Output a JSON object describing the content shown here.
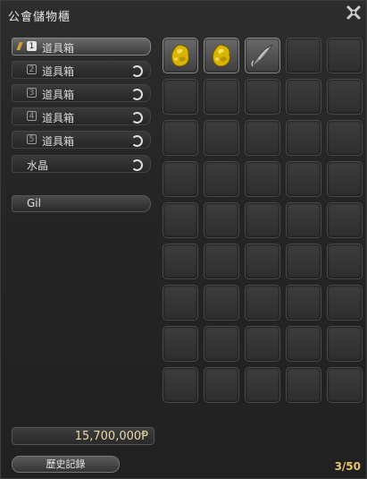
{
  "window": {
    "title": "公會儲物櫃"
  },
  "tabs": [
    {
      "num": "1",
      "label": "道具箱",
      "active": true
    },
    {
      "num": "2",
      "label": "道具箱"
    },
    {
      "num": "3",
      "label": "道具箱"
    },
    {
      "num": "4",
      "label": "道具箱"
    },
    {
      "num": "5",
      "label": "道具箱"
    },
    {
      "label": "水晶"
    }
  ],
  "gil_tab": {
    "label": "Gil"
  },
  "gil_amount": "15,700,000Ᵽ",
  "history_button": "歷史記錄",
  "slot_count": "3/50",
  "slots": {
    "total": 45,
    "items": [
      "gold-ore-icon",
      "gold-ore-icon",
      "fishing-lure-icon"
    ]
  }
}
